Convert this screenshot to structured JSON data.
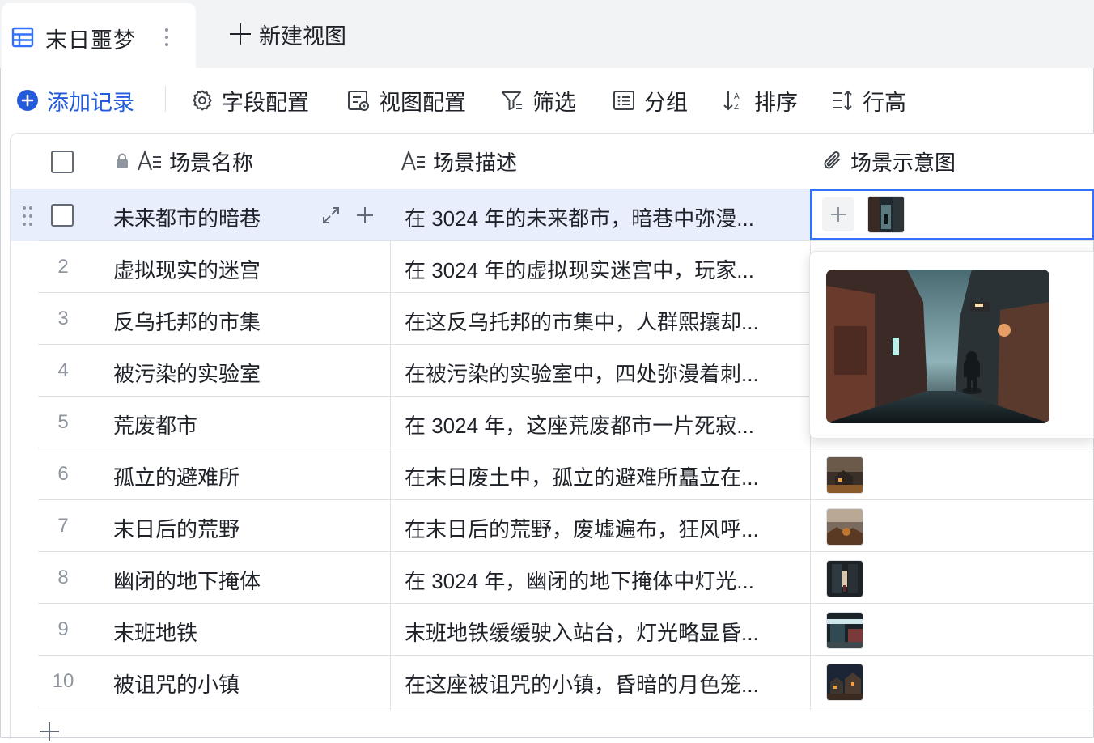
{
  "view_tab": {
    "name": "末日噩梦",
    "new_view_label": "新建视图"
  },
  "toolbar": {
    "add_record": "添加记录",
    "field_config": "字段配置",
    "view_config": "视图配置",
    "filter": "筛选",
    "group": "分组",
    "sort": "排序",
    "row_height": "行高"
  },
  "columns": [
    "场景名称",
    "场景描述",
    "场景示意图"
  ],
  "rows": [
    {
      "num": "",
      "name": "未来都市的暗巷",
      "desc": "在 3024 年的未来都市，暗巷中弥漫...",
      "thumb": "alley"
    },
    {
      "num": "2",
      "name": "虚拟现实的迷宫",
      "desc": "在 3024 年的虚拟现实迷宫中，玩家...",
      "thumb": ""
    },
    {
      "num": "3",
      "name": "反乌托邦的市集",
      "desc": "在这反乌托邦的市集中，人群熙攘却...",
      "thumb": ""
    },
    {
      "num": "4",
      "name": "被污染的实验室",
      "desc": "在被污染的实验室中，四处弥漫着刺...",
      "thumb": ""
    },
    {
      "num": "5",
      "name": "荒废都市",
      "desc": "在 3024 年，这座荒废都市一片死寂...",
      "thumb": ""
    },
    {
      "num": "6",
      "name": "孤立的避难所",
      "desc": "在末日废土中，孤立的避难所矗立在...",
      "thumb": "shelter"
    },
    {
      "num": "7",
      "name": "末日后的荒野",
      "desc": "在末日后的荒野，废墟遍布，狂风呼...",
      "thumb": "wasteland"
    },
    {
      "num": "8",
      "name": "幽闭的地下掩体",
      "desc": "在 3024 年，幽闭的地下掩体中灯光...",
      "thumb": "bunker"
    },
    {
      "num": "9",
      "name": "末班地铁",
      "desc": "末班地铁缓缓驶入站台，灯光略显昏...",
      "thumb": "subway"
    },
    {
      "num": "10",
      "name": "被诅咒的小镇",
      "desc": "在这座被诅咒的小镇，昏暗的月色笼...",
      "thumb": "town"
    }
  ],
  "colors": {
    "accent": "#245bdb",
    "selected_row": "#e8eefc",
    "active_border": "#3370ff"
  }
}
